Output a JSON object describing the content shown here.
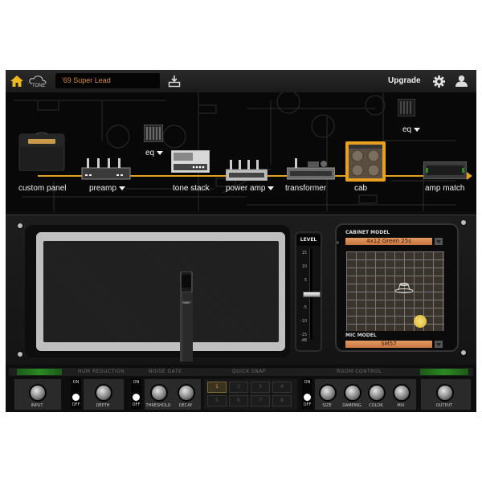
{
  "topbar": {
    "home_icon": "home-icon",
    "tone_logo": "TONE",
    "preset_name": "'69 Super Lead",
    "save_icon": "save-download-icon",
    "upgrade_label": "Upgrade",
    "settings_icon": "gear-icon",
    "account_icon": "user-icon"
  },
  "signal_chain": {
    "modules": [
      {
        "label": "custom panel",
        "dropdown": false
      },
      {
        "label": "preamp",
        "dropdown": true
      },
      {
        "label": "eq",
        "dropdown": true
      },
      {
        "label": "tone stack",
        "dropdown": false
      },
      {
        "label": "power amp",
        "dropdown": true
      },
      {
        "label": "transformer",
        "dropdown": false
      },
      {
        "label": "cab",
        "dropdown": false,
        "selected": true
      },
      {
        "label": "eq",
        "dropdown": true
      },
      {
        "label": "amp match",
        "dropdown": false
      }
    ],
    "accent_color": "#e0a020"
  },
  "cabinet": {
    "mic_label": "SM57",
    "level": {
      "title": "LEVEL",
      "ticks": [
        "15",
        "10",
        "5",
        "0",
        "-5",
        "-10",
        "-15"
      ],
      "unit": "dB",
      "value_db": 0
    },
    "cabinet_model_label": "CABINET MODEL",
    "cabinet_model_value": "4x12 Green 25s",
    "mic_model_label": "MIC MODEL",
    "mic_model_value": "SM57"
  },
  "controls": {
    "sections": {
      "hum_reduction": "HUM REDUCTION",
      "noise_gate": "NOISE GATE",
      "quick_snap": "QUICK SNAP",
      "room_control": "ROOM CONTROL"
    },
    "knobs": {
      "input": "INPUT",
      "depth": "DEPTH",
      "threshold": "THRESHOLD",
      "decay": "DECAY",
      "size": "SIZE",
      "damping": "DAMPING",
      "color": "COLOR",
      "mix": "MIX",
      "output": "OUTPUT"
    },
    "switch_on": "ON",
    "switch_off": "OFF",
    "switches": {
      "hum_reduction": "OFF",
      "noise_gate": "OFF",
      "room_control": "OFF"
    },
    "snaps": [
      "1",
      "2",
      "3",
      "4",
      "5",
      "6",
      "7",
      "8"
    ],
    "active_snap": "1"
  }
}
